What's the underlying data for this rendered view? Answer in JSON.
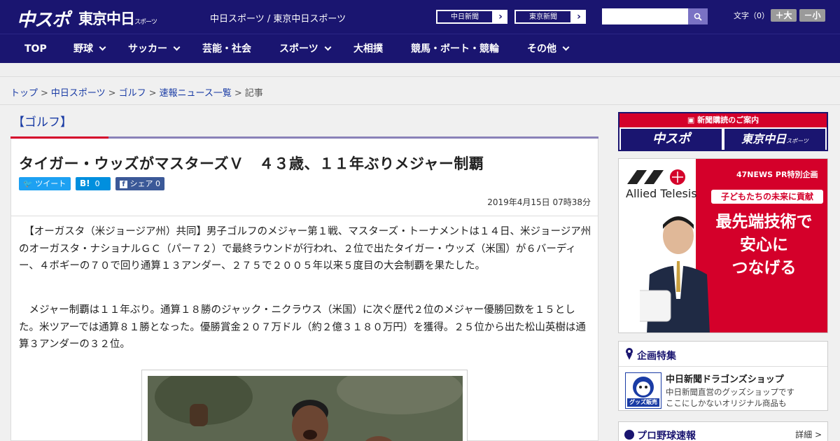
{
  "header": {
    "logo_main": "中スポ",
    "logo_tokyo": "東京中日",
    "logo_tokyo_suffix": "スポーツ",
    "site_names": "中日スポーツ / 東京中日スポーツ",
    "ext_links": [
      "中日新聞",
      "東京新聞"
    ],
    "search_placeholder": "",
    "font_size_label": "文字（0）",
    "font_larger": "＋大",
    "font_smaller": "－小"
  },
  "nav": {
    "items": [
      {
        "label": "TOP"
      },
      {
        "label": "野球"
      },
      {
        "label": "サッカー"
      },
      {
        "label": "芸能・社会"
      },
      {
        "label": "スポーツ"
      },
      {
        "label": "大相撲"
      },
      {
        "label": "競馬・ボート・競輪"
      },
      {
        "label": "その他"
      }
    ]
  },
  "breadcrumb": {
    "items": [
      "トップ",
      "中日スポーツ",
      "ゴルフ",
      "速報ニュース一覧"
    ],
    "current": "記事",
    "separator": ">"
  },
  "article": {
    "category": "【ゴルフ】",
    "title": "タイガー・ウッズがマスターズＶ　４３歳、１１年ぶりメジャー制覇",
    "share": {
      "tweet": "ツイート",
      "hatena_label": "B!",
      "hatena_count": "0",
      "fb_label": "シェア",
      "fb_count": "0"
    },
    "date": "2019年4月15日 07時38分",
    "paragraphs": [
      "　【オーガスタ（米ジョージア州）共同】男子ゴルフのメジャー第１戦、マスターズ・トーナメントは１４日、米ジョージア州のオーガスタ・ナショナルＧＣ（パー７２）で最終ラウンドが行われ、２位で出たタイガー・ウッズ（米国）が６バーディー、４ボギーの７０で回り通算１３アンダー、２７５で２００５年以来５度目の大会制覇を果たした。",
      "　メジャー制覇は１１年ぶり。通算１８勝のジャック・ニクラウス（米国）に次ぐ歴代２位のメジャー優勝回数を１５とした。米ツアーでは通算８１勝となった。優勝賞金２０７万ドル（約２億３１８０万円）を獲得。２５位から出た松山英樹は通算３アンダーの３２位。"
    ]
  },
  "sidebar": {
    "subscribe_title": "新聞購読のご案内",
    "subscribe_links": [
      "中スポ",
      "東京中日"
    ],
    "subscribe_tokyo_suffix": "スポーツ",
    "ad": {
      "brand": "Allied Telesis",
      "tag": "47NEWS PR特別企画",
      "badge": "子どもたちの未来に貢献",
      "headline": [
        "最先端技術で",
        "安心に",
        "つなげる"
      ]
    },
    "feature": {
      "title": "企画特集",
      "item_title": "中日新聞ドラゴンズショップ",
      "item_desc_1": "中日新聞直営のグッズショップです",
      "item_desc_2": "ここにしかないオリジナル商品も",
      "thumb_text": "グッズ販売中"
    },
    "baseball": {
      "title": "プロ野球速報",
      "more": "詳細 >"
    }
  },
  "colors": {
    "brand_navy": "#1a1570",
    "accent_red": "#d4002a",
    "link_blue": "#1a3ca5"
  }
}
